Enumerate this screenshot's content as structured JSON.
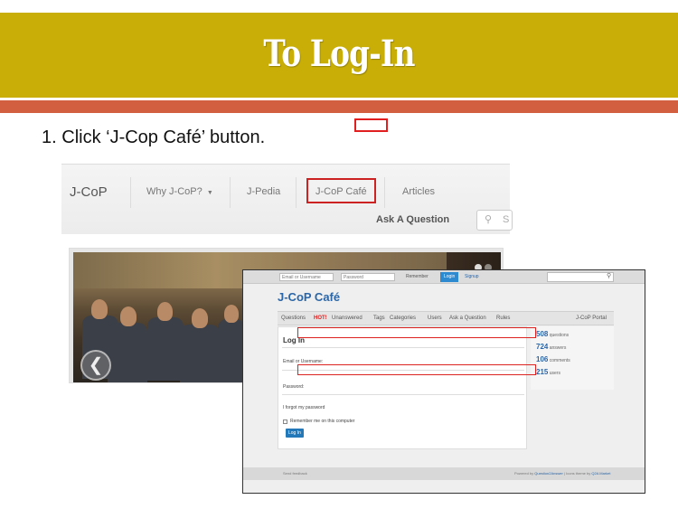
{
  "slide": {
    "title": "To Log-In",
    "step_number": "1.",
    "step_text": "Click ‘J-Cop Café’ button.",
    "colors": {
      "title_band": "#c8ae07",
      "accent_band": "#d25f40",
      "highlight": "#e02020"
    }
  },
  "site_header": {
    "logo": "J-CoP",
    "nav": [
      {
        "label": "Why J-CoP?",
        "icon": "caret-down-icon"
      },
      {
        "label": "J-Pedia"
      },
      {
        "label": "J-CoP Café",
        "highlighted": true
      },
      {
        "label": "Articles"
      }
    ],
    "ask_label": "Ask A Question",
    "search_icon": "magnifier-icon",
    "search_letter": "S"
  },
  "banner": {
    "prev_icon": "chevron-left-icon",
    "slides_count": 2,
    "active_slide": 1
  },
  "cafe_page": {
    "topbar": {
      "username_placeholder": "Email or Username",
      "password_placeholder": "Password",
      "remember": "Remember",
      "login_btn": "Login",
      "signup": "Signup"
    },
    "title": "J-CoP Café",
    "nav": [
      "Questions",
      "HOT!",
      "Unanswered",
      "Tags",
      "Categories",
      "Users",
      "Ask a Question",
      "Rules"
    ],
    "portal_link": "J-CoP Portal",
    "login": {
      "heading": "Log In",
      "email_label": "Email or Username:",
      "password_label": "Password:",
      "forgot": "I forgot my password",
      "remember": "Remember me on this computer",
      "button": "Log In"
    },
    "stats": [
      {
        "value": "508",
        "label": "questions"
      },
      {
        "value": "724",
        "label": "answers"
      },
      {
        "value": "106",
        "label": "comments"
      },
      {
        "value": "215",
        "label": "users"
      }
    ],
    "footer": {
      "left": "Send feedback",
      "right_prefix": "Powered by",
      "engine": "Question2Answer",
      "right_mid": "| Icons theme by",
      "theme": "Q2A Market"
    }
  }
}
